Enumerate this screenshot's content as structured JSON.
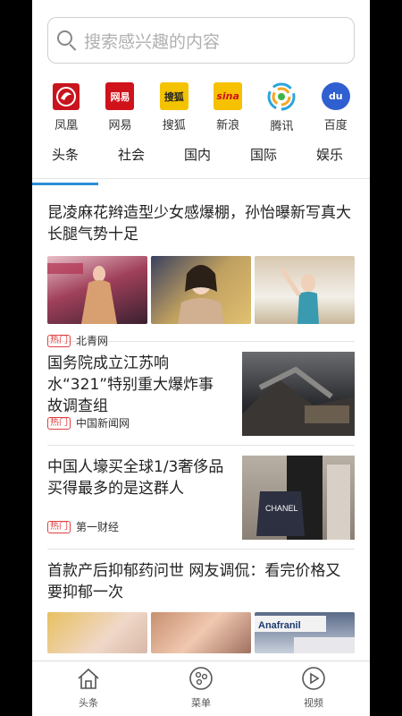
{
  "search": {
    "placeholder": "搜索感兴趣的内容",
    "icon": "search-icon"
  },
  "sources": [
    {
      "label": "凤凰",
      "icon": "ifeng-logo-icon"
    },
    {
      "label": "网易",
      "icon": "netease-logo-icon",
      "logo_text": "网易"
    },
    {
      "label": "搜狐",
      "icon": "sohu-logo-icon",
      "logo_text": "搜狐"
    },
    {
      "label": "新浪",
      "icon": "sina-logo-icon",
      "logo_text": "sina"
    },
    {
      "label": "腾讯",
      "icon": "tencent-logo-icon"
    },
    {
      "label": "百度",
      "icon": "baidu-logo-icon",
      "logo_text": "du"
    }
  ],
  "tabs": [
    {
      "label": "头条",
      "active": true
    },
    {
      "label": "社会"
    },
    {
      "label": "国内"
    },
    {
      "label": "国际"
    },
    {
      "label": "娱乐"
    }
  ],
  "articles": [
    {
      "title": "昆凌麻花辫造型少女感爆棚，孙怡曝新写真大长腿气势十足",
      "badge": "热门",
      "source": "北青网",
      "layout": "three-images"
    },
    {
      "title": "国务院成立江苏响水“321”特别重大爆炸事故调查组",
      "badge": "热门",
      "source": "中国新闻网",
      "layout": "side-image"
    },
    {
      "title": "中国人壕买全球1/3奢侈品 买得最多的是这群人",
      "badge": "热门",
      "source": "第一财经",
      "layout": "side-image",
      "image_text": "CHANEL"
    },
    {
      "title": "首款产后抑郁药问世 网友调侃：看完价格又要抑郁一次",
      "layout": "three-images",
      "image_text": "Anafranil"
    }
  ],
  "navbar": [
    {
      "label": "头条",
      "icon": "home-icon"
    },
    {
      "label": "菜单",
      "icon": "menu-dots-icon"
    },
    {
      "label": "视频",
      "icon": "play-icon"
    }
  ],
  "colors": {
    "accent": "#2d8fd7",
    "hot_badge": "#e04040",
    "divider": "#e4e4e4"
  }
}
